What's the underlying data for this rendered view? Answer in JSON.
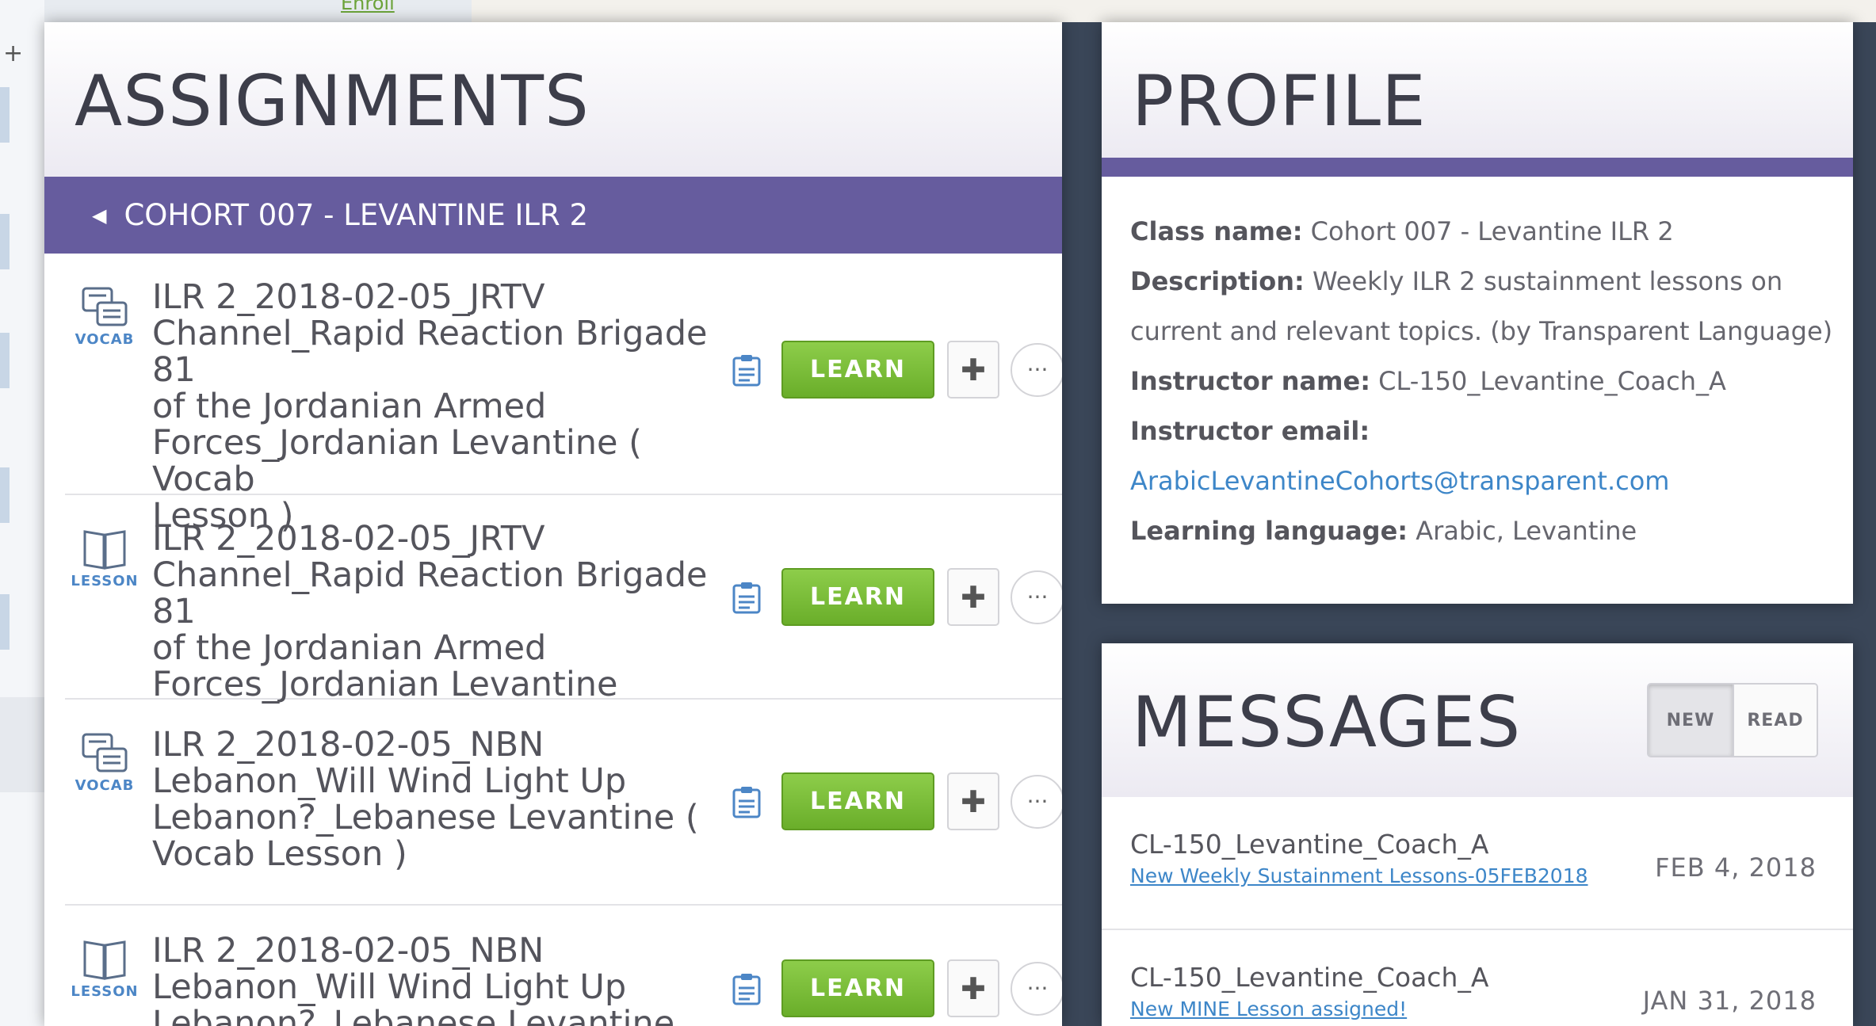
{
  "top_link": "Enroll",
  "assignments": {
    "title": "ASSIGNMENTS",
    "cohort": "COHORT 007 - LEVANTINE ILR 2",
    "learn_label": "LEARN",
    "rows": [
      {
        "type": "VOCAB",
        "icon": "vocab-icon",
        "lines": [
          "ILR 2_2018-02-05_JRTV",
          "Channel_Rapid Reaction Brigade 81",
          "of the Jordanian Armed",
          "Forces_Jordanian Levantine ( Vocab",
          "Lesson )"
        ]
      },
      {
        "type": "LESSON",
        "icon": "lesson-book-icon",
        "lines": [
          "ILR 2_2018-02-05_JRTV",
          "Channel_Rapid Reaction Brigade 81",
          "of the Jordanian Armed",
          "Forces_Jordanian Levantine"
        ]
      },
      {
        "type": "VOCAB",
        "icon": "vocab-icon",
        "lines": [
          "ILR 2_2018-02-05_NBN",
          "Lebanon_Will Wind Light Up",
          "Lebanon?_Lebanese Levantine (",
          "Vocab Lesson )"
        ]
      },
      {
        "type": "LESSON",
        "icon": "lesson-book-icon",
        "lines": [
          "ILR 2_2018-02-05_NBN",
          "Lebanon_Will Wind Light Up",
          "Lebanon?_Lebanese Levantine"
        ]
      }
    ]
  },
  "profile": {
    "title": "PROFILE",
    "class_name_label": "Class name:",
    "class_name": " Cohort 007 - Levantine ILR 2",
    "description_label": "Description:",
    "description_1": " Weekly ILR 2 sustainment lessons on",
    "description_2": "current and relevant topics. (by Transparent Language)",
    "instructor_name_label": "Instructor name:",
    "instructor_name": " CL-150_Levantine_Coach_A",
    "instructor_email_label": "Instructor email:",
    "instructor_email": "ArabicLevantineCohorts@transparent.com",
    "language_label": "Learning language:",
    "language": " Arabic, Levantine"
  },
  "messages": {
    "title": "MESSAGES",
    "toggle_new": "NEW",
    "toggle_read": "READ",
    "items": [
      {
        "from": "CL-150_Levantine_Coach_A",
        "subject": "New Weekly Sustainment Lessons-05FEB2018",
        "date": "FEB 4, 2018"
      },
      {
        "from": "CL-150_Levantine_Coach_A",
        "subject": "New MINE Lesson assigned!",
        "date": "JAN 31, 2018"
      }
    ]
  },
  "colors": {
    "purple": "#665c9e",
    "learn_green": "#7ac03a",
    "link_blue": "#3d86c8",
    "background": "#3a4658"
  }
}
